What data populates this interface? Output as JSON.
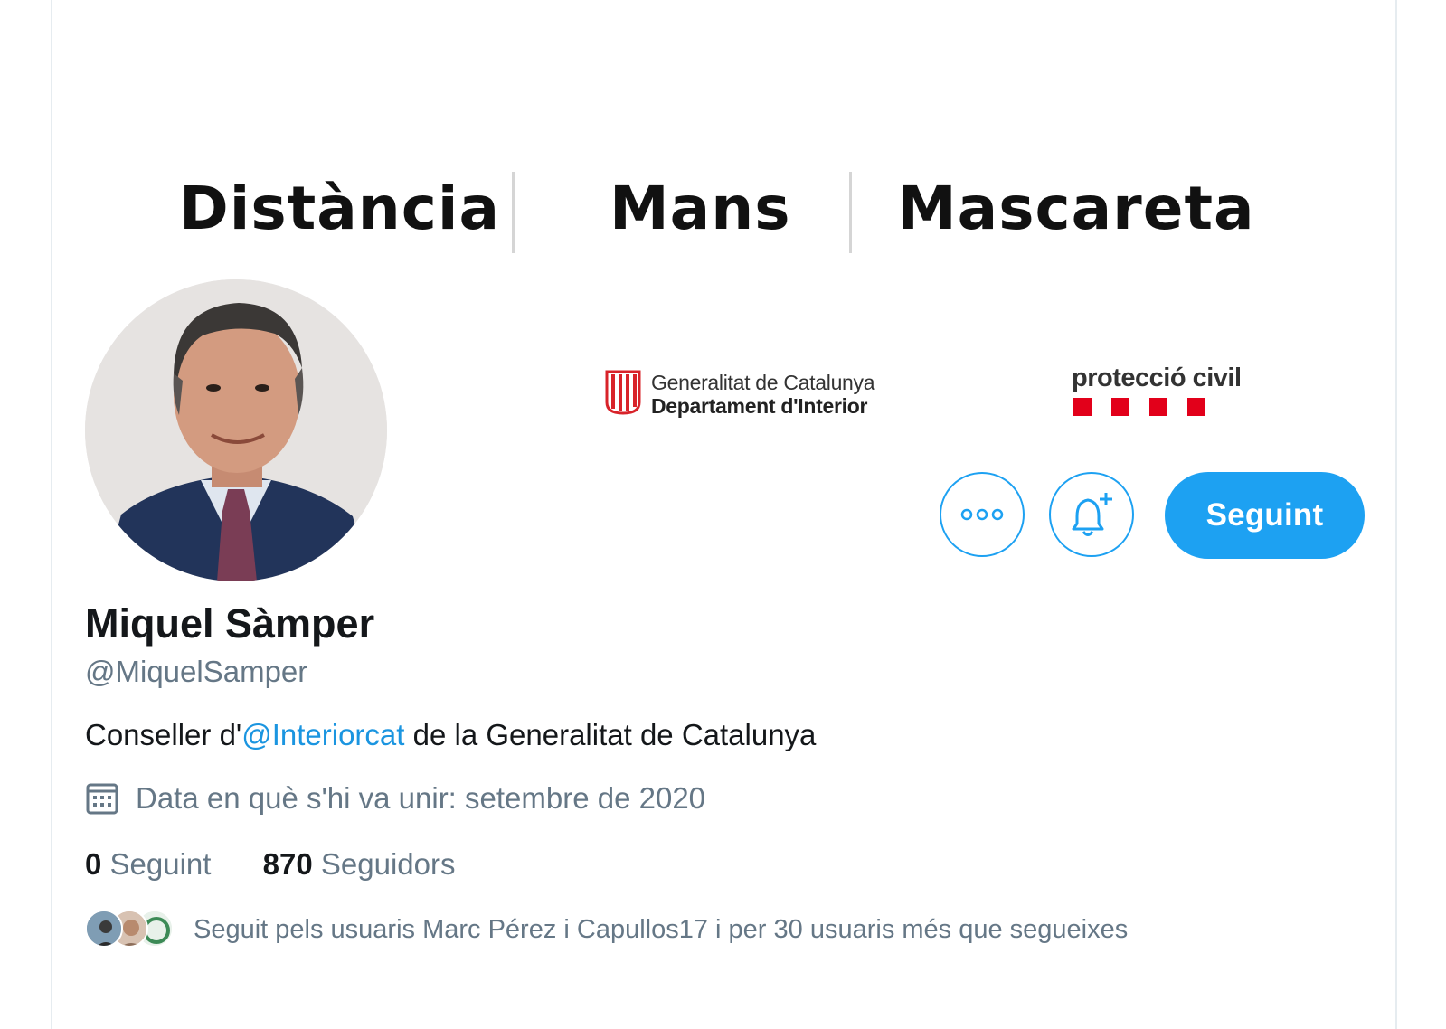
{
  "banner": {
    "words": [
      "Distància",
      "Mans",
      "Mascareta"
    ],
    "logos": {
      "gencat_line1": "Generalitat de Catalunya",
      "gencat_line2": "Departament d'Interior",
      "proteccio": "protecció civil"
    }
  },
  "profile": {
    "name": "Miquel Sàmper",
    "handle": "@MiquelSamper",
    "bio_prefix": "Conseller d'",
    "bio_mention": "@Interiorcat",
    "bio_suffix": " de la Generalitat de Catalunya",
    "joined": "Data en què s'hi va unir: setembre de 2020"
  },
  "actions": {
    "more_icon": "more-dots-icon",
    "notify_icon": "bell-plus-icon",
    "follow_label": "Seguint"
  },
  "stats": {
    "following_count": "0",
    "following_label": "Seguint",
    "followers_count": "870",
    "followers_label": "Seguidors"
  },
  "followed_by": {
    "text": "Seguit pels usuaris Marc Pérez i Capullos17 i per 30 usuaris més que segueixes"
  },
  "colors": {
    "accent": "#1da1f2",
    "secondary_text": "#657786",
    "primary_text": "#14171a",
    "senyera_red": "#d8232a"
  }
}
